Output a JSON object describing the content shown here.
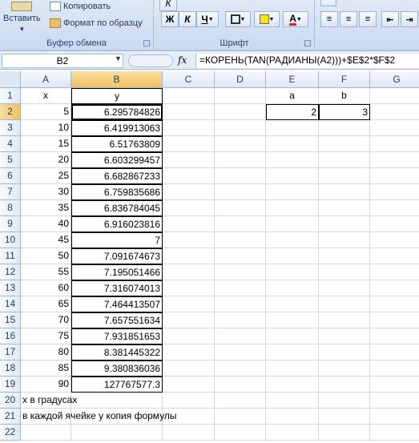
{
  "ribbon": {
    "paste_label": "Вставить",
    "copy_label": "Копировать",
    "format_painter_label": "Формат по образцу",
    "clipboard_group": "Буфер обмена",
    "font_group": "Шрифт",
    "italic": "К",
    "bold": "Ж",
    "underline": "Ч",
    "font_color_letter": "А"
  },
  "formula_bar": {
    "name_box": "B2",
    "fx": "fx",
    "formula": "=КОРЕНЬ(TAN(РАДИАНЫ(A2)))+$E$2*$F$2"
  },
  "columns": [
    "A",
    "B",
    "C",
    "D",
    "E",
    "F",
    "G"
  ],
  "rows": [
    "1",
    "2",
    "3",
    "4",
    "5",
    "6",
    "7",
    "8",
    "9",
    "10",
    "11",
    "12",
    "13",
    "14",
    "15",
    "16",
    "17",
    "18",
    "19",
    "20",
    "21",
    "22"
  ],
  "headers": {
    "x": "x",
    "y": "y",
    "a": "a",
    "b": "b"
  },
  "params": {
    "a": "2",
    "b": "3"
  },
  "x_values": [
    "5",
    "10",
    "15",
    "20",
    "25",
    "30",
    "35",
    "40",
    "45",
    "50",
    "55",
    "60",
    "65",
    "70",
    "75",
    "80",
    "85",
    "90"
  ],
  "y_values": [
    "6.295784826",
    "6.419913063",
    "6.51763809",
    "6.603299457",
    "6.682867233",
    "6.759835686",
    "6.836784045",
    "6.916023816",
    "7",
    "7.091674673",
    "7.195051466",
    "7.316074013",
    "7.464413507",
    "7.657551634",
    "7.931851653",
    "8.381445322",
    "9.380836036",
    "127767577.3"
  ],
  "notes": {
    "row20": "x в градусах",
    "row21": "в каждой ячейке y копия формулы"
  },
  "colors": {
    "ribbon": "#c9daef",
    "selected_header": "#f1c15f",
    "grid_line": "#d0d7e5"
  }
}
